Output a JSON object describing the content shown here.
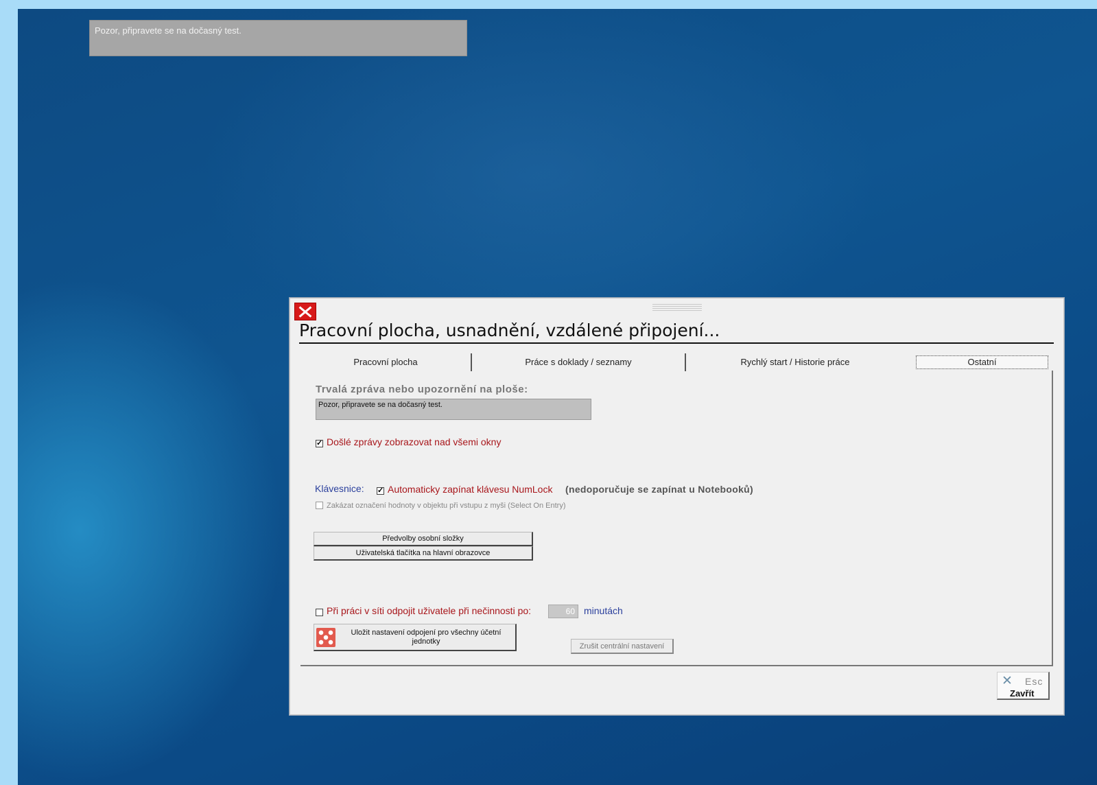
{
  "desktop": {
    "notice_text": "Pozor, připravete se na dočasný test."
  },
  "dialog": {
    "title": "Pracovní plocha, usnadnění, vzdálené připojení...",
    "tabs": [
      {
        "label": "Pracovní plocha",
        "active": false
      },
      {
        "label": "Práce s doklady / seznamy",
        "active": false
      },
      {
        "label": "Rychlý start / Historie práce",
        "active": false
      },
      {
        "label": "Ostatní",
        "active": true
      }
    ],
    "message_label": "Trvalá zpráva nebo upozornění na ploše:",
    "message_value": "Pozor, připravete se na dočasný test.",
    "show_messages_on_top": {
      "checked": true,
      "label": "Došlé zprávy zobrazovat nad všemi okny"
    },
    "keyboard_label": "Klávesnice:",
    "numlock": {
      "checked": true,
      "label": "Automaticky zapínat klávesu NumLock",
      "note": "(nedoporučuje se zapínat u Notebooků)"
    },
    "select_on_entry": {
      "checked": false,
      "enabled": false,
      "label": "Zakázat označení hodnoty v objektu při vstupu z myši (Select On Entry)"
    },
    "buttons": {
      "personal_folder": "Předvolby osobní složky",
      "user_buttons": "Uživatelská tlačítka na hlavní obrazovce",
      "save_disconnect": "Uložit nastavení odpojení pro všechny účetní jednotky",
      "cancel_central": "Zrušit centrální nastavení"
    },
    "idle_disconnect": {
      "checked": false,
      "label": "Při práci v síti odpojit uživatele při nečinnosti po:",
      "minutes": "60",
      "unit": "minutách"
    },
    "close": {
      "key": "Esc",
      "label": "Zavřít"
    }
  },
  "colors": {
    "desktop_bg": "#0f5590",
    "outer_border": "#a9dcf8",
    "accent_red": "#a8161b",
    "accent_blue": "#2a3f9c"
  }
}
